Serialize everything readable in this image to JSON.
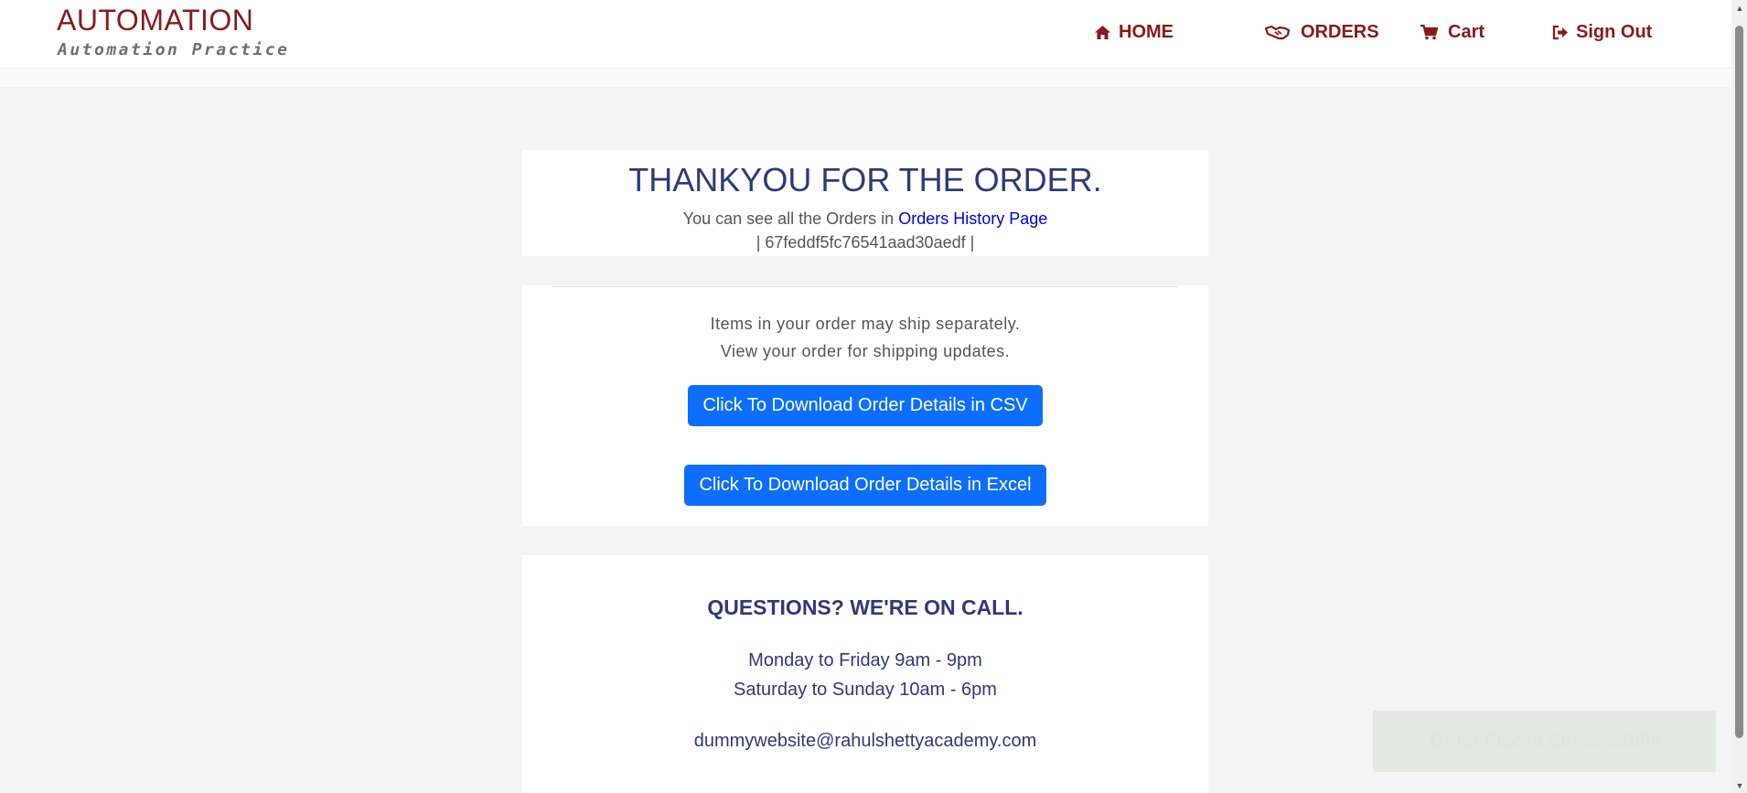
{
  "header": {
    "brand_title": "AUTOMATION",
    "brand_subtitle": "Automation Practice",
    "nav": {
      "home": "HOME",
      "orders": "ORDERS",
      "cart": "Cart",
      "sign_out": "Sign Out"
    }
  },
  "confirmation": {
    "title": "THANKYOU FOR THE ORDER.",
    "history_prefix": "You can see all the Orders in",
    "history_link": "Orders History Page",
    "order_id": "| 67feddf5fc76541aad30aedf |"
  },
  "shipping": {
    "line1": "Items in your order may ship separately.",
    "line2": "View your order for shipping updates.",
    "csv_button": "Click To Download Order Details in CSV",
    "excel_button": "Click To Download Order Details in Excel"
  },
  "contact": {
    "title": "QUESTIONS? WE'RE ON CALL.",
    "weekday_hours": "Monday to Friday 9am - 9pm",
    "weekend_hours": "Saturday to Sunday 10am - 6pm",
    "email": "dummywebsite@rahulshettyacademy.com"
  },
  "toast": {
    "message": "Order Placed Successfully",
    "icon": "check-icon"
  },
  "colors": {
    "brand": "#8b1a1a",
    "navy_text": "#2d3a7b",
    "button_blue": "#0d6efd",
    "link_blue": "#0000ee",
    "page_bg": "#f4f4f4"
  }
}
